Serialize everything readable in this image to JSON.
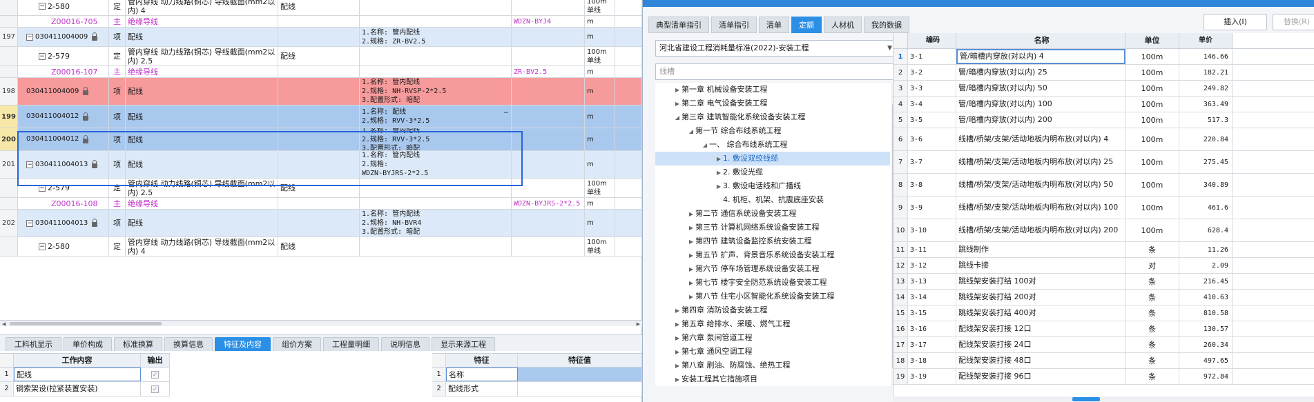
{
  "main_rows": [
    {
      "no": "",
      "code": "2-580",
      "type": "定",
      "name": "管内穿线 动力线路(铜芯) 导线截面(mm2以内) 4",
      "feat_name": "配线",
      "spec": [],
      "src": "",
      "unit": "100m单线",
      "kind": "sub"
    },
    {
      "no": "",
      "code": "Z00016-705",
      "type": "主",
      "name": "绝缘导线",
      "feat_name": "",
      "spec": [],
      "src": "WDZN-BYJ4",
      "unit": "m",
      "kind": "mat"
    },
    {
      "no": "197",
      "code": "030411004009",
      "type": "项",
      "name": "配线",
      "feat_name": "",
      "spec": [
        "1.名称: 管内配线",
        "2.规格: ZR-BV2.5"
      ],
      "src": "",
      "unit": "m",
      "kind": "blue"
    },
    {
      "no": "",
      "code": "2-579",
      "type": "定",
      "name": "管内穿线 动力线路(铜芯) 导线截面(mm2以内) 2.5",
      "feat_name": "配线",
      "spec": [],
      "src": "",
      "unit": "100m单线",
      "kind": "sub"
    },
    {
      "no": "",
      "code": "Z00016-107",
      "type": "主",
      "name": "绝缘导线",
      "feat_name": "",
      "spec": [],
      "src": "ZR-BV2.5",
      "unit": "m",
      "kind": "mat"
    },
    {
      "no": "198",
      "code": "030411004009",
      "type": "项",
      "name": "配线",
      "feat_name": "",
      "spec": [
        "1.名称: 管内配线",
        "2.规格: NH-RVSP-2*2.5",
        "3.配置形式: 暗配"
      ],
      "src": "",
      "unit": "m",
      "kind": "red"
    },
    {
      "no": "199",
      "code": "030411004012",
      "type": "项",
      "name": "配线",
      "feat_name": "",
      "spec": [
        "1.名称: 配线",
        "2.规格: RVV-3*2.5"
      ],
      "src": "",
      "unit": "m",
      "kind": "sel"
    },
    {
      "no": "200",
      "code": "030411004012",
      "type": "项",
      "name": "配线",
      "feat_name": "",
      "spec": [
        "1.名称: 管内配线",
        "2.规格: RVV-3*2.5",
        "3.配置形式: 暗配"
      ],
      "src": "",
      "unit": "m",
      "kind": "sel"
    },
    {
      "no": "201",
      "code": "030411004013",
      "type": "项",
      "name": "配线",
      "feat_name": "",
      "spec": [
        "1.名称: 管内配线",
        "2.规格:",
        "WDZN-BYJRS-2*2.5"
      ],
      "src": "",
      "unit": "m",
      "kind": "blue"
    },
    {
      "no": "",
      "code": "2-579",
      "type": "定",
      "name": "管内穿线 动力线路(铜芯) 导线截面(mm2以内) 2.5",
      "feat_name": "配线",
      "spec": [],
      "src": "",
      "unit": "100m单线",
      "kind": "sub"
    },
    {
      "no": "",
      "code": "Z00016-108",
      "type": "主",
      "name": "绝缘导线",
      "feat_name": "",
      "spec": [],
      "src": "WDZN-BYJRS-2*2.5",
      "unit": "m",
      "kind": "mat"
    },
    {
      "no": "202",
      "code": "030411004013",
      "type": "项",
      "name": "配线",
      "feat_name": "",
      "spec": [
        "1.名称: 管内配线",
        "2.规格: NH-BVR4",
        "3.配置形式: 暗配"
      ],
      "src": "",
      "unit": "m",
      "kind": "blue"
    },
    {
      "no": "",
      "code": "2-580",
      "type": "定",
      "name": "管内穿线 动力线路(铜芯) 导线截面(mm2以内) 4",
      "feat_name": "配线",
      "spec": [],
      "src": "",
      "unit": "100m单线",
      "kind": "sub"
    }
  ],
  "cell_more": "…",
  "bottom_tabs": [
    "工料机显示",
    "单价构成",
    "标准换算",
    "换算信息",
    "特征及内容",
    "组价方案",
    "工程量明细",
    "说明信息",
    "显示来源工程"
  ],
  "bottom_active": 4,
  "work": {
    "col1": "工作内容",
    "col2": "输出",
    "rows": [
      {
        "n": "1",
        "text": "配线"
      },
      {
        "n": "2",
        "text": "钢索架设(拉紧装置安装)"
      }
    ]
  },
  "feature": {
    "col1": "特征",
    "col2": "特征值",
    "rows": [
      {
        "n": "1",
        "text": "名称"
      },
      {
        "n": "2",
        "text": "配线形式"
      }
    ]
  },
  "dialog": {
    "tabs": [
      "典型清单指引",
      "清单指引",
      "清单",
      "定额",
      "人材机",
      "我的数据"
    ],
    "active_tab": 3,
    "insert_label": "插入(I)",
    "replace_label": "替换(R)",
    "standard": "河北省建设工程消耗量标准(2022)-安装工程",
    "search_value": "线槽",
    "tree": [
      {
        "label": "第一章 机械设备安装工程",
        "lvl": 1,
        "arrow": "▶"
      },
      {
        "label": "第二章 电气设备安装工程",
        "lvl": 1,
        "arrow": "▶"
      },
      {
        "label": "第三章 建筑智能化系统设备安装工程",
        "lvl": 1,
        "arrow": "◢"
      },
      {
        "label": "第一节 综合布线系统工程",
        "lvl": 2,
        "arrow": "◢"
      },
      {
        "label": "一、 综合布线系统工程",
        "lvl": 3,
        "arrow": "◢"
      },
      {
        "label": "1. 敷设双绞线缆",
        "lvl": 4,
        "arrow": "▶",
        "sel": true
      },
      {
        "label": "2. 敷设光缆",
        "lvl": 4,
        "arrow": "▶"
      },
      {
        "label": "3. 敷设电话线和广播线",
        "lvl": 4,
        "arrow": "▶"
      },
      {
        "label": "4. 机柜、机架、抗震底座安装",
        "lvl": 4,
        "arrow": ""
      },
      {
        "label": "第二节 通信系统设备安装工程",
        "lvl": 2,
        "arrow": "▶"
      },
      {
        "label": "第三节 计算机网络系统设备安装工程",
        "lvl": 2,
        "arrow": "▶"
      },
      {
        "label": "第四节 建筑设备监控系统安装工程",
        "lvl": 2,
        "arrow": "▶"
      },
      {
        "label": "第五节 扩声、背景音乐系统设备安装工程",
        "lvl": 2,
        "arrow": "▶"
      },
      {
        "label": "第六节 停车场管理系统设备安装工程",
        "lvl": 2,
        "arrow": "▶"
      },
      {
        "label": "第七节 楼宇安全防范系统设备安装工程",
        "lvl": 2,
        "arrow": "▶"
      },
      {
        "label": "第八节 住宅小区智能化系统设备安装工程",
        "lvl": 2,
        "arrow": "▶"
      },
      {
        "label": "第四章 消防设备安装工程",
        "lvl": 1,
        "arrow": "▶"
      },
      {
        "label": "第五章 给排水、采暖、燃气工程",
        "lvl": 1,
        "arrow": "▶"
      },
      {
        "label": "第六章 泵间管道工程",
        "lvl": 1,
        "arrow": "▶"
      },
      {
        "label": "第七章 通风空调工程",
        "lvl": 1,
        "arrow": "▶"
      },
      {
        "label": "第八章 刷油、防腐蚀、绝热工程",
        "lvl": 1,
        "arrow": "▶"
      },
      {
        "label": "安装工程其它措施项目",
        "lvl": 1,
        "arrow": "▶"
      }
    ],
    "code_header": {
      "code": "编码",
      "name": "名称",
      "unit": "单位",
      "price": "单价"
    },
    "codes": [
      {
        "n": "1",
        "code": "3-1",
        "name": "管/暗槽内穿放(对以内) 4",
        "unit": "100m",
        "price": "146.66"
      },
      {
        "n": "2",
        "code": "3-2",
        "name": "管/暗槽内穿放(对以内) 25",
        "unit": "100m",
        "price": "182.21"
      },
      {
        "n": "3",
        "code": "3-3",
        "name": "管/暗槽内穿放(对以内) 50",
        "unit": "100m",
        "price": "249.82"
      },
      {
        "n": "4",
        "code": "3-4",
        "name": "管/暗槽内穿放(对以内) 100",
        "unit": "100m",
        "price": "363.49"
      },
      {
        "n": "5",
        "code": "3-5",
        "name": "管/暗槽内穿放(对以内) 200",
        "unit": "100m",
        "price": "517.3"
      },
      {
        "n": "6",
        "code": "3-6",
        "name": "线槽/桥架/支架/活动地板内明布放(对以内) 4",
        "unit": "100m",
        "price": "220.84"
      },
      {
        "n": "7",
        "code": "3-7",
        "name": "线槽/桥架/支架/活动地板内明布放(对以内) 25",
        "unit": "100m",
        "price": "275.45"
      },
      {
        "n": "8",
        "code": "3-8",
        "name": "线槽/桥架/支架/活动地板内明布放(对以内) 50",
        "unit": "100m",
        "price": "340.89"
      },
      {
        "n": "9",
        "code": "3-9",
        "name": "线槽/桥架/支架/活动地板内明布放(对以内) 100",
        "unit": "100m",
        "price": "461.6"
      },
      {
        "n": "10",
        "code": "3-10",
        "name": "线槽/桥架/支架/活动地板内明布放(对以内) 200",
        "unit": "100m",
        "price": "628.4"
      },
      {
        "n": "11",
        "code": "3-11",
        "name": "跳线制作",
        "unit": "条",
        "price": "11.26"
      },
      {
        "n": "12",
        "code": "3-12",
        "name": "跳线卡接",
        "unit": "对",
        "price": "2.09"
      },
      {
        "n": "13",
        "code": "3-13",
        "name": "跳线架安装打结 100对",
        "unit": "条",
        "price": "216.45"
      },
      {
        "n": "14",
        "code": "3-14",
        "name": "跳线架安装打结 200对",
        "unit": "条",
        "price": "410.63"
      },
      {
        "n": "15",
        "code": "3-15",
        "name": "跳线架安装打结 400对",
        "unit": "条",
        "price": "810.58"
      },
      {
        "n": "16",
        "code": "3-16",
        "name": "配线架安装打接 12口",
        "unit": "条",
        "price": "130.57"
      },
      {
        "n": "17",
        "code": "3-17",
        "name": "配线架安装打接 24口",
        "unit": "条",
        "price": "260.34"
      },
      {
        "n": "18",
        "code": "3-18",
        "name": "配线架安装打接 48口",
        "unit": "条",
        "price": "497.65"
      },
      {
        "n": "19",
        "code": "3-19",
        "name": "配线架安装打接 96口",
        "unit": "条",
        "price": "972.84"
      }
    ]
  }
}
